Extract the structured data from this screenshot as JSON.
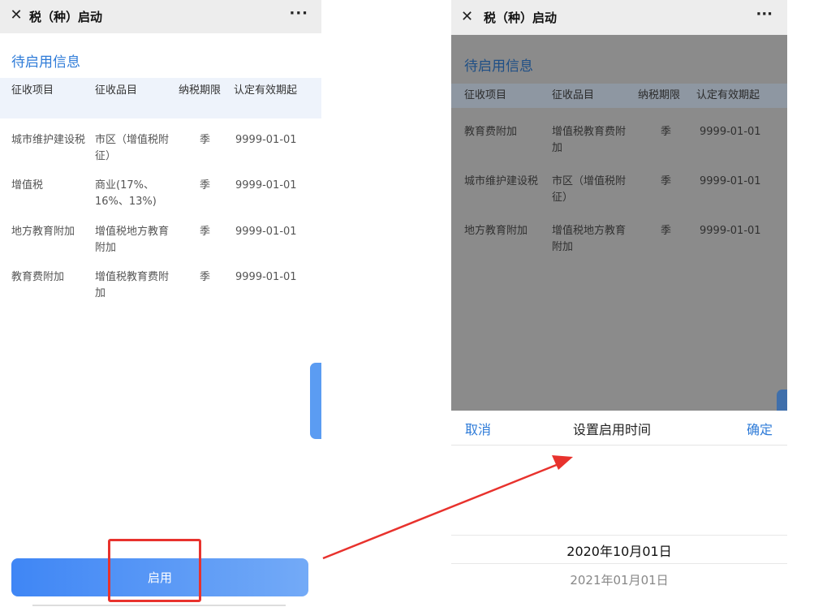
{
  "window": {
    "title": "税（种）启动"
  },
  "left_screen": {
    "section_title": "待启用信息",
    "columns": [
      "征收项目",
      "征收品目",
      "纳税期限",
      "认定有效期起"
    ],
    "rows": [
      {
        "item": "城市维护建设税",
        "category": "市区（增值税附征）",
        "period": "季",
        "valid_from": "9999-01-01"
      },
      {
        "item": "增值税",
        "category": "商业(17%、16%、13%)",
        "period": "季",
        "valid_from": "9999-01-01"
      },
      {
        "item": "地方教育附加",
        "category": "增值税地方教育附加",
        "period": "季",
        "valid_from": "9999-01-01"
      },
      {
        "item": "教育费附加",
        "category": "增值税教育费附加",
        "period": "季",
        "valid_from": "9999-01-01"
      }
    ],
    "start_button_label": "启用"
  },
  "right_screen": {
    "section_title": "待启用信息",
    "columns": [
      "征收项目",
      "征收品目",
      "纳税期限",
      "认定有效期起"
    ],
    "rows": [
      {
        "item": "教育费附加",
        "category": "增值税教育费附加",
        "period": "季",
        "valid_from": "9999-01-01"
      },
      {
        "item": "城市维护建设税",
        "category": "市区（增值税附征）",
        "period": "季",
        "valid_from": "9999-01-01"
      },
      {
        "item": "地方教育附加",
        "category": "增值税地方教育附加",
        "period": "季",
        "valid_from": "9999-01-01"
      }
    ],
    "picker": {
      "cancel_label": "取消",
      "title": "设置启用时间",
      "confirm_label": "确定",
      "selected_date": "2020年10月01日",
      "next_date": "2021年01月01日"
    }
  },
  "colors": {
    "accent": "#2e7bd8",
    "button_gradient_start": "#3f86f5",
    "button_gradient_end": "#73aaf7",
    "highlight": "#e8322d"
  },
  "icons": [
    "close-icon",
    "more-icon",
    "arrow-annotation"
  ]
}
